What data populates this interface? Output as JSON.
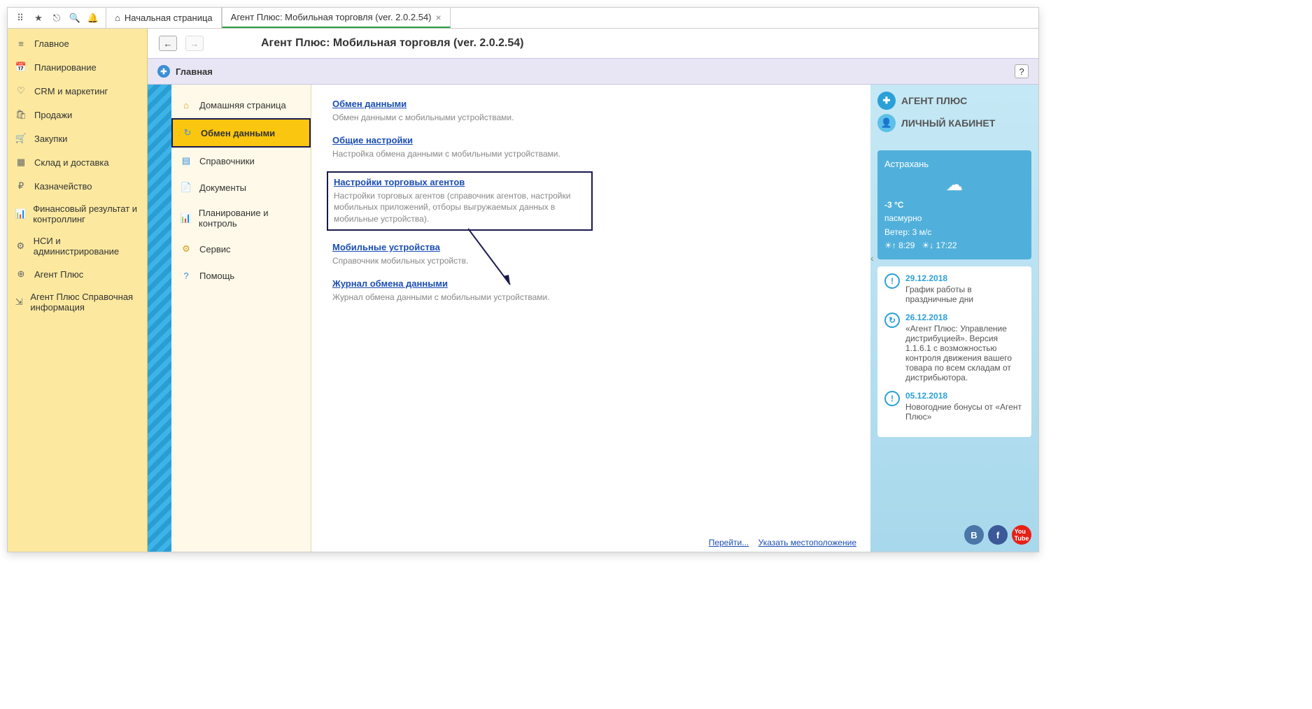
{
  "topbar": {
    "tabs": [
      {
        "label": "Начальная страница"
      },
      {
        "label": "Агент Плюс: Мобильная торговля (ver. 2.0.2.54)"
      }
    ]
  },
  "sidebar": {
    "items": [
      {
        "label": "Главное"
      },
      {
        "label": "Планирование"
      },
      {
        "label": "CRM и маркетинг"
      },
      {
        "label": "Продажи"
      },
      {
        "label": "Закупки"
      },
      {
        "label": "Склад и доставка"
      },
      {
        "label": "Казначейство"
      },
      {
        "label": "Финансовый результат и контроллинг"
      },
      {
        "label": "НСИ и администрирование"
      },
      {
        "label": "Агент Плюс"
      },
      {
        "label": "Агент Плюс Справочная информация"
      }
    ]
  },
  "content": {
    "title": "Агент Плюс: Мобильная торговля (ver. 2.0.2.54)",
    "subheader": "Главная",
    "help": "?"
  },
  "submenu": {
    "items": [
      {
        "label": "Домашняя страница"
      },
      {
        "label": "Обмен данными"
      },
      {
        "label": "Справочники"
      },
      {
        "label": "Документы"
      },
      {
        "label": "Планирование и контроль"
      },
      {
        "label": "Сервис"
      },
      {
        "label": "Помощь"
      }
    ]
  },
  "sections": [
    {
      "link": "Обмен данными",
      "desc": "Обмен данными с мобильными устройствами."
    },
    {
      "link": "Общие настройки",
      "desc": "Настройка обмена данными с мобильными устройствами."
    },
    {
      "link": "Настройки торговых агентов",
      "desc": "Настройки торговых агентов (справочник агентов, настройки мобильных приложений, отборы выгружаемых данных в мобильные устройства)."
    },
    {
      "link": "Мобильные устройства",
      "desc": "Справочник мобильных устройств."
    },
    {
      "link": "Журнал обмена данными",
      "desc": "Журнал обмена данными с мобильными устройствами."
    }
  ],
  "footer": {
    "link1": "Перейти...",
    "link2": "Указать местоположение"
  },
  "rightpanel": {
    "brand1": "АГЕНТ ПЛЮС",
    "brand2": "ЛИЧНЫЙ КАБИНЕТ",
    "weather": {
      "city": "Астрахань",
      "temp": "-3 °С",
      "cond": "пасмурно",
      "wind": "Ветер: 3 м/с",
      "sunrise": "8:29",
      "sunset": "17:22"
    },
    "news": [
      {
        "date": "29.12.2018",
        "text": "График работы в праздничные дни",
        "icon": "!"
      },
      {
        "date": "26.12.2018",
        "text": "«Агент Плюс: Управление дистрибуцией». Версия 1.1.6.1 с возможностью контроля движения вашего товара по всем складам от дистрибьютора.",
        "icon": "↻"
      },
      {
        "date": "05.12.2018",
        "text": "Новогодние бонусы от «Агент Плюс»",
        "icon": "!"
      }
    ]
  }
}
